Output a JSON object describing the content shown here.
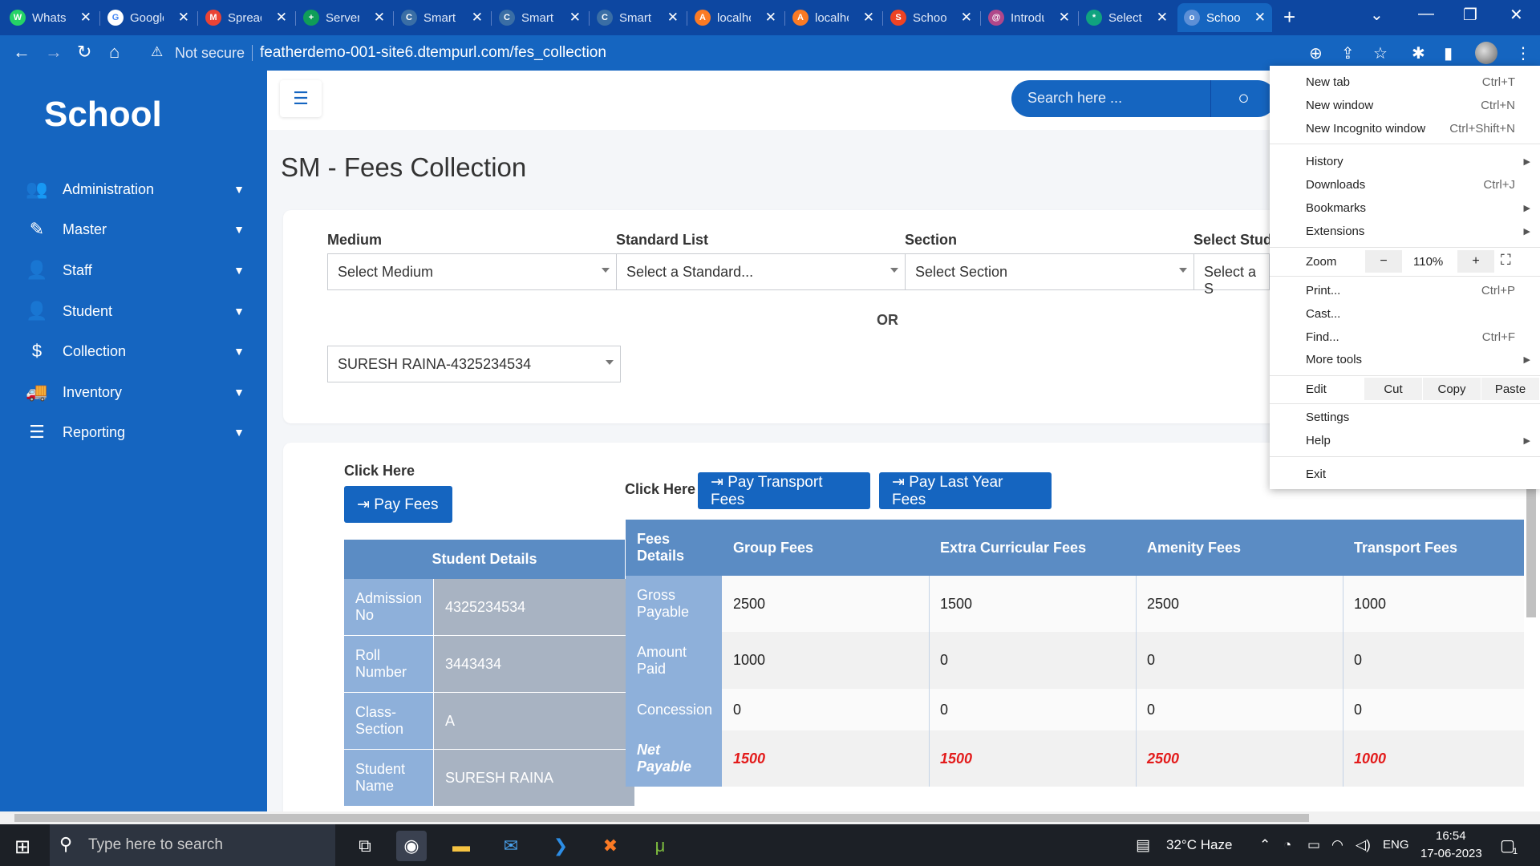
{
  "browser": {
    "tabs": [
      {
        "title": "WhatsApp",
        "icon": "whatsapp-icon",
        "color": "#25d366",
        "glyph": "W"
      },
      {
        "title": "Google",
        "icon": "google-icon",
        "color": "#ffffff",
        "glyph": "G"
      },
      {
        "title": "Spreadsheet",
        "icon": "gmail-icon",
        "color": "#ea4335",
        "glyph": "M"
      },
      {
        "title": "Server",
        "icon": "sheets-icon",
        "color": "#0f9d58",
        "glyph": "+"
      },
      {
        "title": "Smart",
        "icon": "edge-icon",
        "color": "#3a6ea5",
        "glyph": "C"
      },
      {
        "title": "Smart",
        "icon": "edge-icon",
        "color": "#3a6ea5",
        "glyph": "C"
      },
      {
        "title": "Smart",
        "icon": "edge-icon",
        "color": "#3a6ea5",
        "glyph": "C"
      },
      {
        "title": "localhost",
        "icon": "xampp-icon",
        "color": "#fb7a24",
        "glyph": "A"
      },
      {
        "title": "localhost",
        "icon": "xampp-icon",
        "color": "#fb7a24",
        "glyph": "A"
      },
      {
        "title": "School",
        "icon": "codeigniter-icon",
        "color": "#ee4323",
        "glyph": "S"
      },
      {
        "title": "Introduction",
        "icon": "web-icon",
        "color": "#b0478a",
        "glyph": "@"
      },
      {
        "title": "Select",
        "icon": "chatgpt-icon",
        "color": "#10a37f",
        "glyph": "*"
      },
      {
        "title": "School",
        "icon": "globe-icon",
        "color": "#5c8fd6",
        "glyph": "o"
      }
    ],
    "new_tab_glyph": "+",
    "security_warning": "Not secure",
    "url": "featherdemo-001-site6.dtempurl.com/fes_collection"
  },
  "menu": {
    "items": [
      {
        "label": "New tab",
        "shortcut": "Ctrl+T"
      },
      {
        "label": "New window",
        "shortcut": "Ctrl+N"
      },
      {
        "label": "New Incognito window",
        "shortcut": "Ctrl+Shift+N"
      },
      {
        "label": "History",
        "shortcut": "",
        "arrow": true
      },
      {
        "label": "Downloads",
        "shortcut": "Ctrl+J"
      },
      {
        "label": "Bookmarks",
        "shortcut": "",
        "arrow": true
      },
      {
        "label": "Extensions",
        "shortcut": "",
        "arrow": true
      }
    ],
    "zoom_label": "Zoom",
    "zoom_minus": "−",
    "zoom_value": "110%",
    "zoom_plus": "+",
    "items2": [
      {
        "label": "Print...",
        "shortcut": "Ctrl+P"
      },
      {
        "label": "Cast...",
        "shortcut": ""
      },
      {
        "label": "Find...",
        "shortcut": "Ctrl+F"
      },
      {
        "label": "More tools",
        "shortcut": "",
        "arrow": true
      }
    ],
    "edit_label": "Edit",
    "cut": "Cut",
    "copy": "Copy",
    "paste": "Paste",
    "settings": "Settings",
    "help": "Help",
    "exit": "Exit"
  },
  "sidebar": {
    "logo": "School",
    "items": [
      {
        "label": "Administration",
        "icon": "users-icon",
        "glyph": "👥"
      },
      {
        "label": "Master",
        "icon": "edit-icon",
        "glyph": "✎"
      },
      {
        "label": "Staff",
        "icon": "user-icon",
        "glyph": "👤"
      },
      {
        "label": "Student",
        "icon": "user-icon",
        "glyph": "👤"
      },
      {
        "label": "Collection",
        "icon": "dollar-icon",
        "glyph": "$"
      },
      {
        "label": "Inventory",
        "icon": "truck-icon",
        "glyph": "🚚"
      },
      {
        "label": "Reporting",
        "icon": "list-icon",
        "glyph": "☰"
      }
    ]
  },
  "header": {
    "search_placeholder": "Search here ..."
  },
  "page": {
    "title": "SM - Fees Collection",
    "filters": [
      {
        "label": "Medium",
        "value": "Select Medium"
      },
      {
        "label": "Standard List",
        "value": "Select a Standard..."
      },
      {
        "label": "Section",
        "value": "Select Section"
      },
      {
        "label": "Select Stud",
        "value": "Select a S"
      }
    ],
    "or_text": "OR",
    "student_select": "SURESH RAINA-4325234534",
    "click_here_1": "Click Here",
    "click_here_2": "Click Here",
    "pay_fees": "⇥ Pay Fees",
    "pay_transport": "⇥ Pay Transport Fees",
    "pay_last_year": "⇥ Pay Last Year Fees"
  },
  "student_details": {
    "title": "Student Details",
    "rows": [
      {
        "label": "Admission No",
        "value": "4325234534"
      },
      {
        "label": "Roll Number",
        "value": "3443434"
      },
      {
        "label": "Class-Section",
        "value": "A"
      },
      {
        "label": "Student Name",
        "value": "SURESH RAINA"
      }
    ]
  },
  "fees_table": {
    "headers": [
      "Fees Details",
      "Group Fees",
      "Extra Curricular Fees",
      "Amenity Fees",
      "Transport Fees"
    ],
    "rows": [
      {
        "label": "Gross Payable",
        "values": [
          "2500",
          "1500",
          "2500",
          "1000"
        ]
      },
      {
        "label": "Amount Paid",
        "values": [
          "1000",
          "0",
          "0",
          "0"
        ]
      },
      {
        "label": "Concession",
        "values": [
          "0",
          "0",
          "0",
          "0"
        ]
      },
      {
        "label": "Net Payable",
        "values": [
          "1500",
          "1500",
          "2500",
          "1000"
        ]
      }
    ]
  },
  "taskbar": {
    "search_placeholder": "Type here to search",
    "weather": "32°C  Haze",
    "language": "ENG",
    "time": "16:54",
    "date": "17-06-2023",
    "notification_count": "1"
  },
  "colors": {
    "primary": "#1565c0",
    "tab_bar": "#0d47a1",
    "table_header": "#5b8cc4",
    "net_payable": "#e31b1b"
  }
}
